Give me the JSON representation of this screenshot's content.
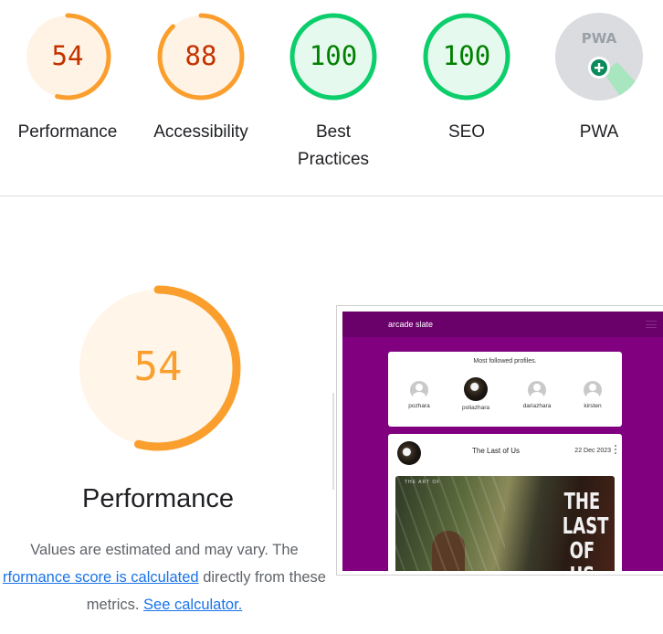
{
  "gauges": [
    {
      "score": "54",
      "label": "Performance",
      "value": 54,
      "color": "#fa9f2e",
      "text_color": "#c33300",
      "bg": "#fff3e6"
    },
    {
      "score": "88",
      "label": "Accessibility",
      "value": 88,
      "color": "#fa9f2e",
      "text_color": "#c33300",
      "bg": "#fff3e6"
    },
    {
      "score": "100",
      "label_line1": "Best",
      "label_line2": "Practices",
      "value": 100,
      "color": "#0cce6b",
      "text_color": "#008000",
      "bg": "#e6f9ee"
    },
    {
      "score": "100",
      "label": "SEO",
      "value": 100,
      "color": "#0cce6b",
      "text_color": "#008000",
      "bg": "#e6f9ee"
    },
    {
      "badge": "PWA",
      "label": "PWA",
      "icon": "pwa-badge-icon"
    }
  ],
  "performance": {
    "score": "54",
    "value": 54,
    "title": "Performance",
    "color": "#fa9f2e",
    "bg": "#fff5e8",
    "desc_text_1": "Values are estimated and may vary. The",
    "desc_link_1": "rformance score is calculated",
    "desc_text_2": "directly from these",
    "desc_text_3": "metrics.",
    "desc_link_2": "See calculator."
  },
  "screenshot": {
    "brand": "arcade slate",
    "card_title": "Most followed profiles.",
    "profiles": [
      "pozhara",
      "poliazhara",
      "dariazhara",
      "kirsten"
    ],
    "post_title": "The Last of Us",
    "post_date": "22 Dec 2023",
    "image_caption": "THE ART OF",
    "image_logo_1": "THE",
    "image_logo_2": "LAST",
    "image_logo_3": "OF US"
  }
}
